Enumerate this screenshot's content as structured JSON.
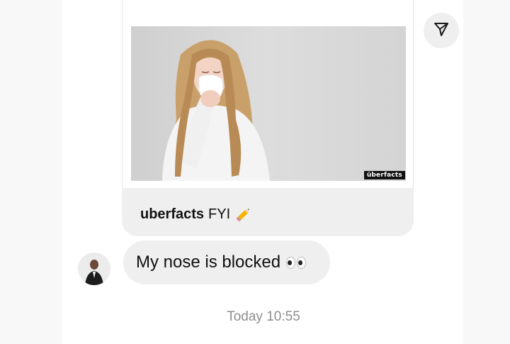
{
  "post": {
    "author": "uberfacts",
    "caption": "FYI",
    "watermark": "überfacts",
    "caption_emoji": "pencil-icon"
  },
  "share": {
    "icon": "send-icon"
  },
  "message": {
    "text": "My nose is blocked",
    "emoji": "eyes-icon"
  },
  "timestamp": "Today 10:55"
}
